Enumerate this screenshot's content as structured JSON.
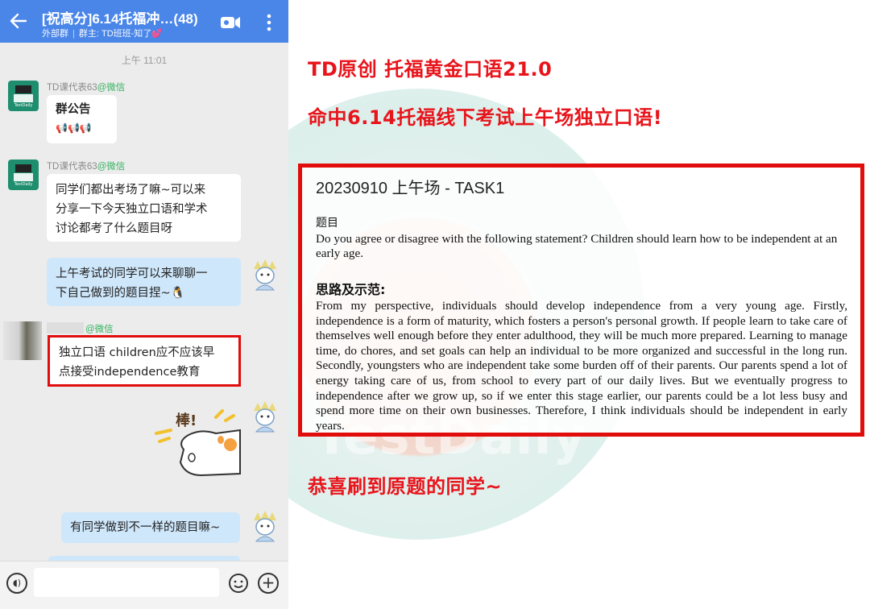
{
  "chat": {
    "header": {
      "title": "[祝高分]6.14托福冲…(48)",
      "sub_tag": "外部群",
      "sub_owner": "群主: TD班班-知了💕"
    },
    "time": "上午 11:01",
    "messages": [
      {
        "sender": "TD课代表63",
        "channel": "@微信",
        "text": "群公告",
        "extra": "📢📢📢"
      },
      {
        "sender": "TD课代表63",
        "channel": "@微信",
        "lines": [
          "同学们都出考场了嘛~可以来",
          "分享一下今天独立口语和学术",
          "讨论都考了什么题目呀"
        ]
      },
      {
        "sender": "me",
        "lines": [
          "上午考试的同学可以来聊聊一",
          "下自己做到的题目捏~🐧"
        ]
      },
      {
        "sender": "",
        "channel": "@微信",
        "lines": [
          "独立口语 children应不应该早",
          "点接受independence教育"
        ]
      },
      {
        "sender": "me",
        "sticker_text": "棒!"
      },
      {
        "sender": "me",
        "text": "有同学做到不一样的题目嘛~"
      }
    ]
  },
  "avatar_label": "TestDaily",
  "watermark": "TestDaily",
  "right": {
    "headline1": "TD原创 托福黄金口语21.0",
    "headline2": "命中6.14托福线下考试上午场独立口语!",
    "task": {
      "title": "20230910 上午场 - TASK1",
      "q_label": "题目",
      "question": "Do you agree or disagree with the following statement? Children should learn how to be independent at an early age.",
      "a_label": "思路及示范:",
      "answer": "From my perspective, individuals should develop independence from a very young age. Firstly, independence is a form of maturity, which fosters a person's personal growth. If people learn to take care of themselves well enough before they enter adulthood, they will be much more prepared. Learning to manage time, do chores, and set goals can help an individual to be more organized and successful in the long run. Secondly, youngsters who are independent take some burden off of their parents. Our parents spend a lot of energy taking care of us, from school to every part of our daily lives. But we eventually progress to independence after we grow up, so if we enter this stage earlier, our parents could be a lot less busy and spend more time on their own businesses. Therefore, I think individuals should be independent in early years."
    },
    "footer": "恭喜刷到原题的同学~"
  },
  "colors": {
    "header_blue": "#4a86e8",
    "accent_red": "#e8141b",
    "bubble_blue": "#cfe7fb",
    "wechat_green": "#35b35f"
  }
}
